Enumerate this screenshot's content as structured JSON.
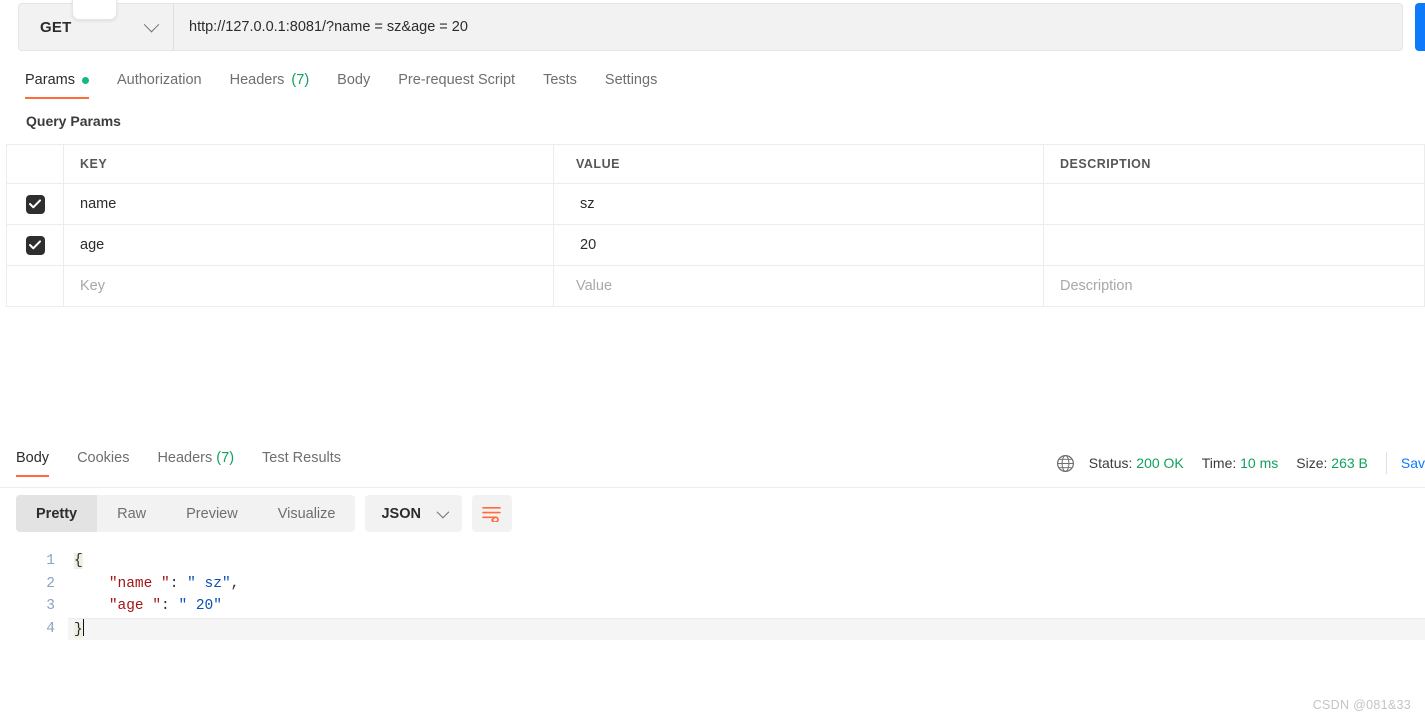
{
  "request": {
    "method": "GET",
    "url": "http://127.0.0.1:8081/?name = sz&age = 20",
    "send_label": "",
    "tabs": [
      {
        "label": "Params",
        "dot": true,
        "active": true
      },
      {
        "label": "Authorization",
        "active": false
      },
      {
        "label": "Headers",
        "count": "(7)",
        "active": false
      },
      {
        "label": "Body",
        "active": false
      },
      {
        "label": "Pre-request Script",
        "active": false
      },
      {
        "label": "Tests",
        "active": false
      },
      {
        "label": "Settings",
        "active": false
      }
    ]
  },
  "params": {
    "section_title": "Query Params",
    "columns": {
      "key": "KEY",
      "value": "VALUE",
      "description": "DESCRIPTION"
    },
    "rows": [
      {
        "checked": true,
        "key": "name ",
        "value": " sz",
        "description": ""
      },
      {
        "checked": true,
        "key": "age ",
        "value": " 20",
        "description": ""
      }
    ],
    "placeholder_row": {
      "key": "Key",
      "value": "Value",
      "description": "Description"
    }
  },
  "response": {
    "tabs": [
      {
        "label": "Body",
        "active": true
      },
      {
        "label": "Cookies",
        "active": false
      },
      {
        "label": "Headers",
        "count": "(7)",
        "active": false
      },
      {
        "label": "Test Results",
        "active": false
      }
    ],
    "meta": {
      "globe_icon": "globe-icon",
      "status_label": "Status:",
      "status_value": "200 OK",
      "time_label": "Time:",
      "time_value": "10 ms",
      "size_label": "Size:",
      "size_value": "263 B",
      "save_label": "Sav"
    },
    "viewer": {
      "modes": [
        {
          "label": "Pretty",
          "active": true
        },
        {
          "label": "Raw",
          "active": false
        },
        {
          "label": "Preview",
          "active": false
        },
        {
          "label": "Visualize",
          "active": false
        }
      ],
      "format": "JSON",
      "wrap_icon": "word-wrap-icon"
    },
    "body_lines": [
      {
        "n": "1",
        "open_brace": "{"
      },
      {
        "n": "2",
        "key": "\"name \"",
        "punct": ": ",
        "value": "\" sz\"",
        "tail": ","
      },
      {
        "n": "3",
        "key": "\"age \"",
        "punct": ": ",
        "value": "\" 20\"",
        "tail": ""
      },
      {
        "n": "4",
        "close_brace": "}"
      }
    ]
  },
  "watermark": "CSDN @081&33",
  "colors": {
    "accent": "#ff6c37",
    "send": "#0d7afc",
    "success": "#10a15e",
    "dot": "#10b981",
    "json_key": "#a31515",
    "json_string": "#0b52b5"
  }
}
